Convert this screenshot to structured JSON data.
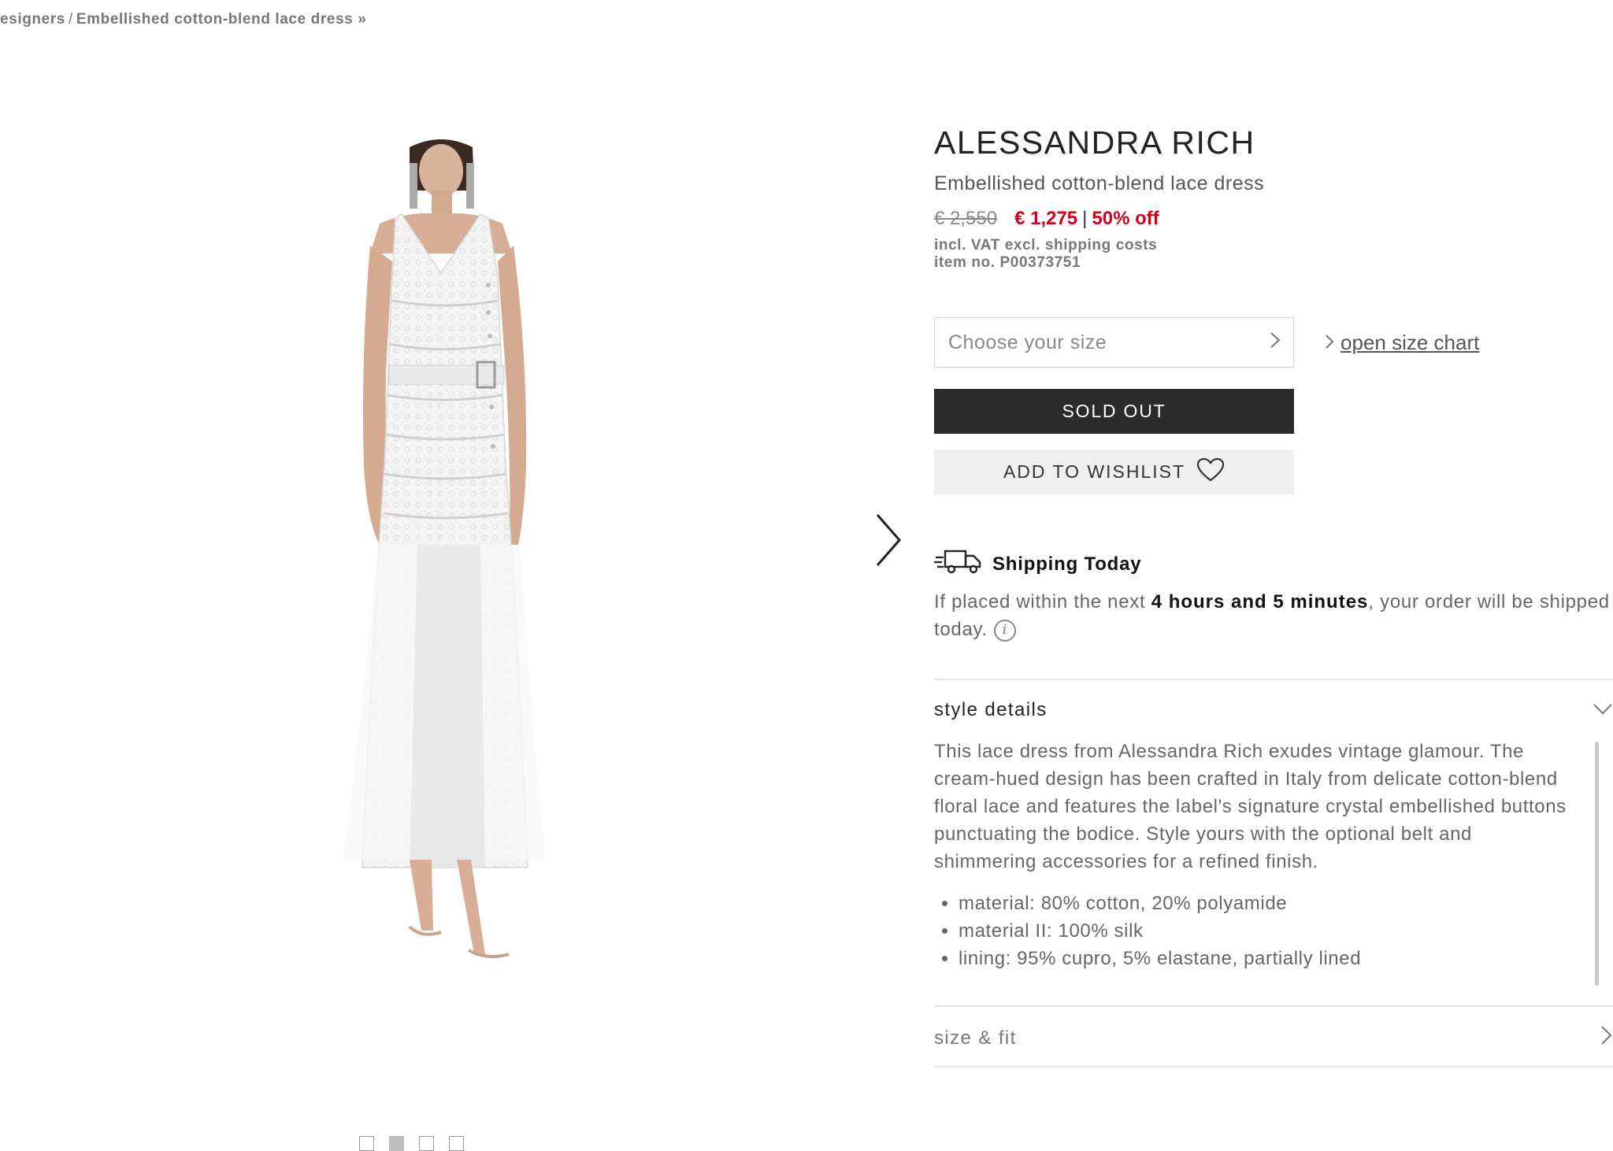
{
  "breadcrumb": {
    "parent": "esigners",
    "current": "Embellished cotton-blend lace dress",
    "separator": "/",
    "trail_icon": "»"
  },
  "gallery": {
    "dots": [
      {
        "active": false
      },
      {
        "active": true
      },
      {
        "active": false
      },
      {
        "active": false
      }
    ]
  },
  "product": {
    "brand": "ALESSANDRA RICH",
    "name": "Embellished cotton-blend lace dress",
    "old_price": "€ 2,550",
    "new_price": "€ 1,275",
    "price_separator": "|",
    "discount": "50% off",
    "vat_note": "incl. VAT excl. shipping costs",
    "item_no": "item no. P00373751"
  },
  "size": {
    "placeholder": "Choose your size",
    "chart_link": "open size chart"
  },
  "buttons": {
    "sold_out": "SOLD OUT",
    "wishlist": "ADD TO WISHLIST"
  },
  "shipping": {
    "title": "Shipping Today",
    "text_before": "If placed within the next ",
    "time": "4 hours and 5 minutes",
    "text_after": ", your order will be shipped today.",
    "info_glyph": "i"
  },
  "style_details": {
    "title": "style details",
    "description": "This lace dress from Alessandra Rich exudes vintage glamour. The cream-hued design has been crafted in Italy from delicate cotton-blend floral lace and features the label's signature crystal embellished buttons punctuating the bodice. Style yours with the optional belt and shimmering accessories for a refined finish.",
    "materials": [
      "material: 80% cotton, 20% polyamide",
      "material II: 100% silk",
      "lining: 95% cupro, 5% elastane, partially lined"
    ]
  },
  "size_fit": {
    "title": "size & fit"
  },
  "colors": {
    "sale_red": "#d0021b",
    "button_dark": "#2b2b2b",
    "wishlist_bg": "#efefef"
  }
}
